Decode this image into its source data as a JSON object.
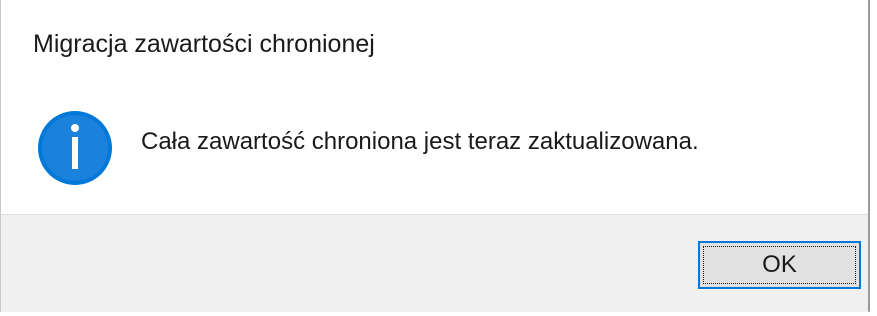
{
  "dialog": {
    "title": "Migracja zawartości chronionej",
    "message": "Cała zawartość chroniona jest teraz zaktualizowana.",
    "icon": "info-icon",
    "ok_label": "OK"
  },
  "colors": {
    "icon_blue": "#0078d7",
    "button_border": "#0078d7",
    "footer_bg": "#f0f0f0",
    "button_bg": "#e1e1e1"
  }
}
